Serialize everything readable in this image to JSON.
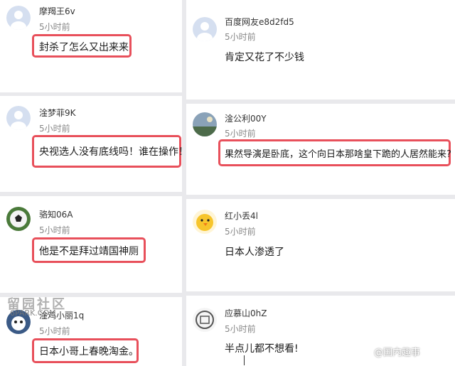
{
  "comments": [
    {
      "user": "摩羯王6v",
      "time": "5小时前",
      "text": "封杀了怎么又出来来",
      "avatar_icon": "default-avatar-icon"
    },
    {
      "user": "百度网友e8d2fd5",
      "time": "5小时前",
      "text": "肯定又花了不少钱",
      "avatar_icon": "default-avatar-icon"
    },
    {
      "user": "淦梦菲9K",
      "time": "5小时前",
      "text": "央视选人没有底线吗！谁在操作！",
      "avatar_icon": "default-avatar-icon"
    },
    {
      "user": "淦公利00Y",
      "time": "5小时前",
      "text": "果然导演是卧底，这个向日本那啥皇下跪的人居然能来?",
      "avatar_icon": "landscape-avatar-icon"
    },
    {
      "user": "骆知06A",
      "time": "5小时前",
      "text": "他是不是拜过靖国神厕",
      "avatar_icon": "soccer-ball-avatar-icon"
    },
    {
      "user": "红小丢4l",
      "time": "5小时前",
      "text": "日本人渗透了",
      "avatar_icon": "chick-avatar-icon"
    },
    {
      "user": "淦鸡小丽1q",
      "time": "5小时前",
      "text": "日本小哥上春晚淘金。",
      "avatar_icon": "cartoon-avatar-icon"
    },
    {
      "user": "应慕山0hZ",
      "time": "5小时前",
      "text": "半点儿都不想看!",
      "avatar_icon": "stamp-avatar-icon"
    }
  ],
  "watermarks": {
    "left_title": "留园社区",
    "left_sub": "6PARK.COM",
    "right": "@国内趣事"
  },
  "colors": {
    "highlight": "#e8505b",
    "background": "#e9e9ec"
  }
}
